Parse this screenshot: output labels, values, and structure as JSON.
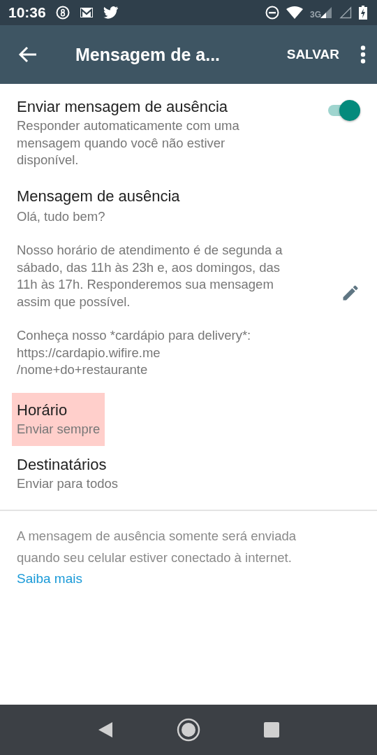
{
  "status_bar": {
    "time": "10:36",
    "network": "3G"
  },
  "app_bar": {
    "title": "Mensagem de a...",
    "action": "SALVAR"
  },
  "settings": [
    {
      "kind": "toggle",
      "title": "Enviar mensagem de ausência",
      "subtitle": "Responder automaticamente com uma\nmensagem quando você não estiver\ndisponível.",
      "on": true,
      "highlighted": false
    },
    {
      "kind": "message",
      "title": "Mensagem de ausência",
      "paragraphs": [
        "Olá, tudo bem?",
        "Nosso horário de atendimento é de segunda a\nsábado, das 11h às 23h e, aos domingos, das\n11h às 17h. Responderemos sua mensagem\nassim que possível.",
        "Conheça nosso *cardápio para delivery*:\nhttps://cardapio.wifire.me\n/nome+do+restaurante"
      ],
      "highlighted": false
    },
    {
      "kind": "plain",
      "title": "Horário",
      "subtitle": "Enviar sempre",
      "highlighted": true
    },
    {
      "kind": "plain",
      "title": "Destinatários",
      "subtitle": "Enviar para todos",
      "highlighted": false
    }
  ],
  "footer": {
    "note": "A mensagem de ausência somente será enviada\nquando seu celular estiver conectado à internet.",
    "link": "Saiba mais"
  }
}
